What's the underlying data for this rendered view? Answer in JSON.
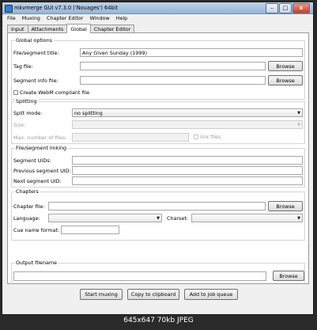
{
  "window": {
    "title": "mkvmerge GUI v7.3.0 ('Nouages') 64bit",
    "buttons": {
      "minimize": "–",
      "maximize": "□",
      "close": "x"
    }
  },
  "menu": [
    "File",
    "Muxing",
    "Chapter Editor",
    "Window",
    "Help"
  ],
  "tabs": [
    "Input",
    "Attachments",
    "Global",
    "Chapter Editor"
  ],
  "active_tab": "Global",
  "global_options": {
    "legend": "Global options",
    "title_label": "File/segment title:",
    "title_value": "Any Given Sunday (1999)",
    "tag_label": "Tag file:",
    "segment_info_label": "Segment info file:",
    "browse": "Browse",
    "webm_label": "Create WebM compliant file"
  },
  "splitting": {
    "legend": "Splitting",
    "mode_label": "Split mode:",
    "mode_value": "no splitting",
    "size_label": "Size:",
    "max_files_label": "Max. number of files:",
    "link_files_label": "link files"
  },
  "linking": {
    "legend": "File/segment linking",
    "segment_uids": "Segment UIDs:",
    "prev_uid": "Previous segment UID:",
    "next_uid": "Next segment UID:"
  },
  "chapters": {
    "legend": "Chapters",
    "chapter_file": "Chapter file:",
    "browse": "Browse",
    "language": "Language:",
    "charset": "Charset:",
    "cue_name": "Cue name format:"
  },
  "output": {
    "legend": "Output filename",
    "browse": "Browse"
  },
  "actions": {
    "start": "Start muxing",
    "copy": "Copy to clipboard",
    "add_job": "Add to job queue"
  },
  "caption": "645x647  70kb  JPEG"
}
